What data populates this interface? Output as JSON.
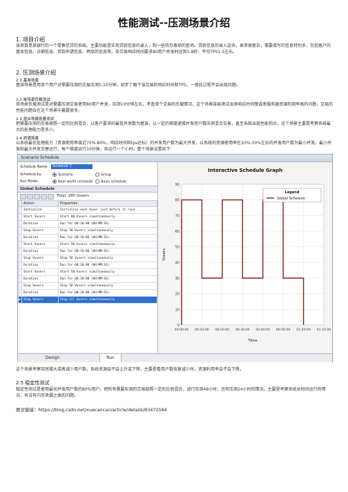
{
  "title": "性能测试--压测场景介绍",
  "sections": {
    "s1": {
      "heading": "1. 项目介绍",
      "body": "该项目是某银行的一个零售信贷的系统。主要功能是实现贷款信息的录入，和一些待办事项的查询。贷款信息的录入这块，表单很复杂，需要填写的信息特别多，包括客户的基本信息、详细信息、贷款申请信息、押品的信息等。各交易响应时间要求80用户并发时达到5-8秒，平均TPS1.5左右。"
    },
    "s2": {
      "heading": "2. 压测场景介绍"
    },
    "s21": {
      "heading": "2.1 基准场景",
      "body": "基准场景是用单个用户对需要压测的交易压测5-10分钟，初步了解下该交易的响应时间和TPS，一般此过程不会出现问题。"
    },
    "s22": {
      "heading": "2.2 单场景负载测试",
      "body": "单场景负载测试是对需要压测交易使用80用户并发，压测10分钟左右，考查单个交易的负载情况。这个场景容易测试出来响应时间慢或者服务器资源利用率高的问题，交易的性能问题会在这个场景中暴露很多。"
    },
    "s23": {
      "heading": "2.3 混合场景容量测试",
      "body": "把需要压测的交易按照一定的比例混合，以客户要求的最低并发数为基准，以一定的梯度递增并发用户数压测混合交易，直至系统出现性能拐点。这个场景主要是考察系统最大的处理能力是多少。"
    },
    "s24": {
      "heading": "2.4 浪涌场景",
      "body": "以系统最优处理能力（资源使用率接近75%-80%，响应时间和tps达标）的并发用户数为最大并发，以系统的资源使用率在20%-30%左右的并发用户数为最小并发。最小并发和最大并发交替运行，每个梯度运行10分钟，共运行一个小时。整个场景设置如下："
    },
    "after_fig": "这个场景考察突然增大或者减少用户数，系统资源会不会上升或下降，主要是看用户数恢复减少时，资源利用率会不会下降。",
    "s25": {
      "heading": "2.5 稳定性测试",
      "body": "稳定性测试是使用最优并发用户数的80%用户，把所有需要压测的交易按照一定的比例混合，进行压测48小时，也有压测24小时的情况。主要是考察系统长时间运行的情况，有没有内存泄漏之类的问题。"
    },
    "source_link": "原文链接：https://blog.csdn.net/xuecancan/article/details/83472584"
  },
  "screenshot": {
    "window_title": "Scenario Schedule",
    "schedule_name_label": "Schedule Name:",
    "schedule_name_value": "Schedule 1",
    "schedule_by_label": "Schedule by:",
    "schedule_by_options": [
      "Scenario",
      "Group"
    ],
    "run_mode_label": "Run Mode:",
    "run_mode_options": [
      "Real-world schedule",
      "Basic schedule"
    ],
    "global_schedule_label": "Global Schedule",
    "total_vusers": "Total: 180 Vusers",
    "columns": [
      "Action",
      "Properties"
    ],
    "rows": [
      [
        "Initialize",
        "Initialize each Vuser just before it runs"
      ],
      [
        "Start  Vusers",
        "Start 80 Vusers simultaneously"
      ],
      [
        "Duration",
        "Run for 00:10:00 (HH:MM:SS)"
      ],
      [
        "Stop  Vusers",
        "Stop 50 Vusers simultaneously"
      ],
      [
        "Duration",
        "Run for 00:10:00 (HH:MM:SS)"
      ],
      [
        "Start  Vusers",
        "Start 50 Vusers simultaneously"
      ],
      [
        "Duration",
        "Run for 00:10:00 (HH:MM:SS)"
      ],
      [
        "Stop  Vusers",
        "Stop 50 Vusers simultaneously"
      ],
      [
        "Duration",
        "Run for 00:10:00 (HH:MM:SS)"
      ],
      [
        "Start  Vusers",
        "Start 50 Vusers simultaneously"
      ],
      [
        "Duration",
        "Run for 00:10:00 (HH:MM:SS)"
      ],
      [
        "Stop  Vusers",
        "Stop 50 Vusers simultaneously"
      ],
      [
        "Duration",
        "Run for 00:10:00 (HH:MM:SS)"
      ],
      [
        "Stop  Vusers",
        "Stop all Vusers simultaneously"
      ]
    ],
    "tabs": [
      "Design",
      "Run"
    ],
    "watermark": "https://blog.csdn.net/..."
  },
  "chart_data": {
    "type": "line",
    "title": "Interactive Schedule Graph",
    "xlabel": "Time",
    "ylabel": "Vusers",
    "ylim": [
      0,
      90
    ],
    "yticks": [
      0,
      10,
      20,
      30,
      40,
      50,
      60,
      70,
      80,
      90
    ],
    "xticks": [
      "00:00:00",
      "00:10:00",
      "00:20:00",
      "00:30:00",
      "00:40:00",
      "00:50:00",
      "01:00:00",
      "01:10:00"
    ],
    "legend_title": "Legend",
    "legend_position": "top-right",
    "grid": true,
    "series": [
      {
        "name": "Global Schedule",
        "color": "#8b1a1a",
        "points": [
          [
            0,
            0
          ],
          [
            0,
            80
          ],
          [
            10,
            80
          ],
          [
            10,
            30
          ],
          [
            20,
            30
          ],
          [
            20,
            80
          ],
          [
            30,
            80
          ],
          [
            30,
            30
          ],
          [
            40,
            30
          ],
          [
            40,
            80
          ],
          [
            50,
            80
          ],
          [
            50,
            30
          ],
          [
            60,
            30
          ],
          [
            60,
            0
          ]
        ]
      }
    ]
  }
}
